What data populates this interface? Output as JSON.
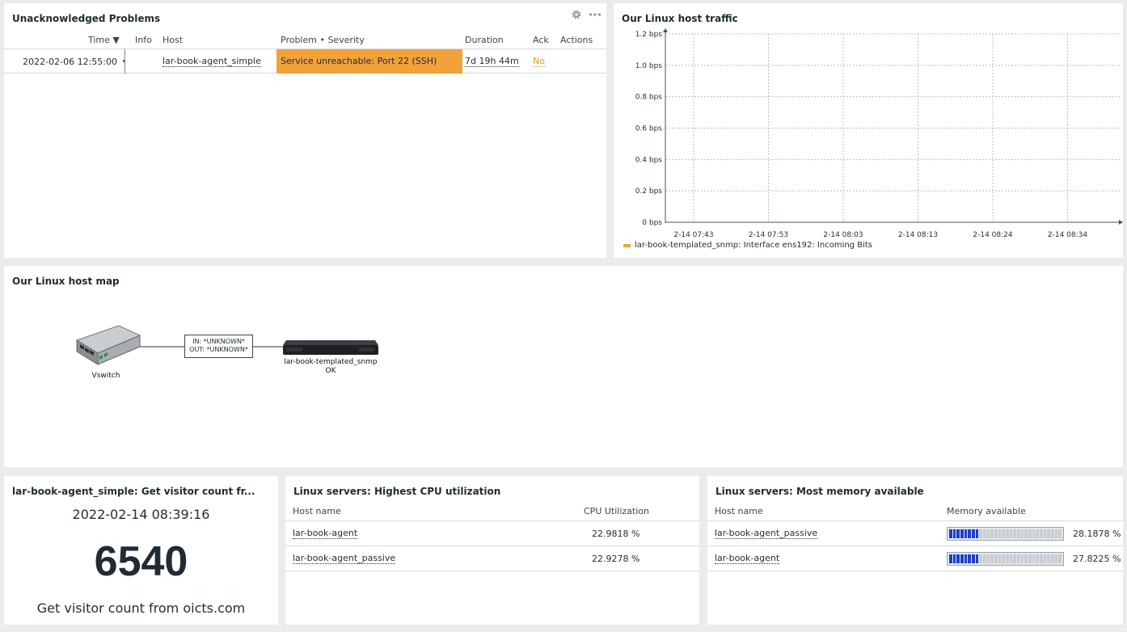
{
  "problems": {
    "title": "Unacknowledged Problems",
    "headers": {
      "time": "Time ▼",
      "info": "Info",
      "host": "Host",
      "problem": "Problem • Severity",
      "duration": "Duration",
      "ack": "Ack",
      "actions": "Actions"
    },
    "rows": [
      {
        "time": "2022-02-06 12:55:00",
        "host": "lar-book-agent_simple",
        "problem": "Service unreachable: Port 22 (SSH)",
        "severity_color": "#f2a23b",
        "duration": "7d 19h 44m",
        "ack": "No"
      }
    ]
  },
  "graph": {
    "title": "Our Linux host traffic",
    "legend": "lar-book-templated_snmp: Interface ens192: Incoming Bits",
    "series_color": "#f2a23b"
  },
  "chart_data": {
    "type": "line",
    "title": "Our Linux host traffic",
    "y_ticks": [
      "0 bps",
      "0.2 bps",
      "0.4 bps",
      "0.6 bps",
      "0.8 bps",
      "1.0 bps",
      "1.2 bps"
    ],
    "x_ticks": [
      "2-14 07:43",
      "2-14 07:53",
      "2-14 08:03",
      "2-14 08:13",
      "2-14 08:24",
      "2-14 08:34"
    ],
    "ylim": [
      0,
      1.2
    ],
    "grid": true,
    "series": [
      {
        "name": "lar-book-templated_snmp: Interface ens192: Incoming Bits",
        "values": []
      }
    ]
  },
  "map": {
    "title": "Our Linux host map",
    "node1_label": "Vswitch",
    "link_in": "IN: *UNKNOWN*",
    "link_out": "OUT: *UNKNOWN*",
    "node2_label": "lar-book-templated_snmp",
    "node2_status": "OK"
  },
  "item": {
    "title": "lar-book-agent_simple: Get visitor count fr...",
    "timestamp": "2022-02-14 08:39:16",
    "value": "6540",
    "description": "Get visitor count from oicts.com"
  },
  "cpu": {
    "title": "Linux servers: Highest CPU utilization",
    "col_host": "Host name",
    "col_value": "CPU Utilization",
    "rows": [
      {
        "host": "lar-book-agent",
        "value": "22.9818 %"
      },
      {
        "host": "lar-book-agent_passive",
        "value": "22.9278 %"
      }
    ]
  },
  "mem": {
    "title": "Linux servers: Most memory available",
    "col_host": "Host name",
    "col_value": "Memory available",
    "rows": [
      {
        "host": "lar-book-agent_passive",
        "value": "28.1878 %",
        "fraction": 0.281878
      },
      {
        "host": "lar-book-agent",
        "value": "27.8225 %",
        "fraction": 0.278225
      }
    ],
    "bar_color": "#1d3ec9"
  }
}
